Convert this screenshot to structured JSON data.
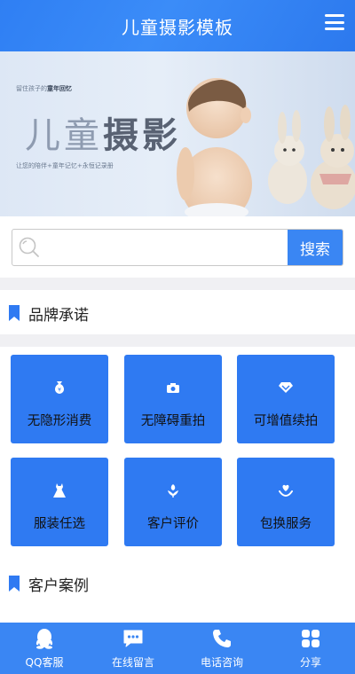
{
  "header": {
    "title": "儿童摄影模板"
  },
  "banner": {
    "tagline_prefix": "留住孩子的",
    "tagline_emphasis": "童年回忆",
    "title_light": "儿童",
    "title_bold": "摄影",
    "subtitle": "让您的陪伴+童年记忆+永恒记录册"
  },
  "search": {
    "placeholder": "",
    "button_label": "搜索"
  },
  "brand_section": {
    "title": "品牌承诺",
    "items": [
      {
        "label": "无隐形消费",
        "icon": "money-bag-icon"
      },
      {
        "label": "无障碍重拍",
        "icon": "camera-icon"
      },
      {
        "label": "可增值续拍",
        "icon": "diamond-icon"
      },
      {
        "label": "服装任选",
        "icon": "dress-icon"
      },
      {
        "label": "客户评价",
        "icon": "flower-icon"
      },
      {
        "label": "包换服务",
        "icon": "heart-hand-icon"
      }
    ]
  },
  "cases_section": {
    "title": "客户案例"
  },
  "bottom_nav": {
    "items": [
      {
        "label": "QQ客服",
        "icon": "qq-icon"
      },
      {
        "label": "在线留言",
        "icon": "message-icon"
      },
      {
        "label": "电话咨询",
        "icon": "phone-icon"
      },
      {
        "label": "分享",
        "icon": "share-grid-icon"
      }
    ]
  },
  "colors": {
    "primary": "#3a86f3",
    "card": "#2f7af2",
    "divider": "#f0f0f3"
  }
}
